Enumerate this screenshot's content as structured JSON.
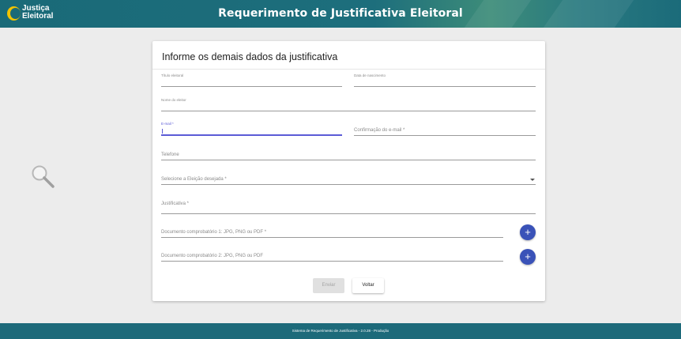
{
  "header": {
    "logo_line1": "Justiça",
    "logo_line2": "Eleitoral",
    "title": "Requerimento de Justificativa Eleitoral"
  },
  "form": {
    "title": "Informe os demais dados da justificativa",
    "titulo_eleitoral_label": "Título eleitoral",
    "data_nascimento_label": "Data de nascimento",
    "nome_eleitor_label": "Nome do eleitor",
    "email_label": "E-mail *",
    "email_confirm_label": "Confirmação do e-mail *",
    "telefone_label": "Telefone",
    "eleicao_label": "Selecione a Eleição desejada *",
    "justificativa_label": "Justificativa *",
    "doc1_label": "Documento comprobatório 1: JPG, PNG ou PDF *",
    "doc2_label": "Documento comprobatório 2: JPG, PNG ou PDF",
    "add_icon": "+",
    "send_label": "Enviar",
    "back_label": "Voltar"
  },
  "footer": {
    "text": "Sistema de Requerimento de Justificativa - 2.0.28 - Produção"
  },
  "colors": {
    "header_bg": "#1a6a78",
    "accent": "#5b5bd6",
    "add_button": "#3a52b8",
    "footer_bg": "#1d6a7a"
  },
  "icons": {
    "logo": "justica-eleitoral-logo",
    "decoration": "magnifier-icon",
    "add": "plus-icon",
    "dropdown": "chevron-down-icon"
  }
}
